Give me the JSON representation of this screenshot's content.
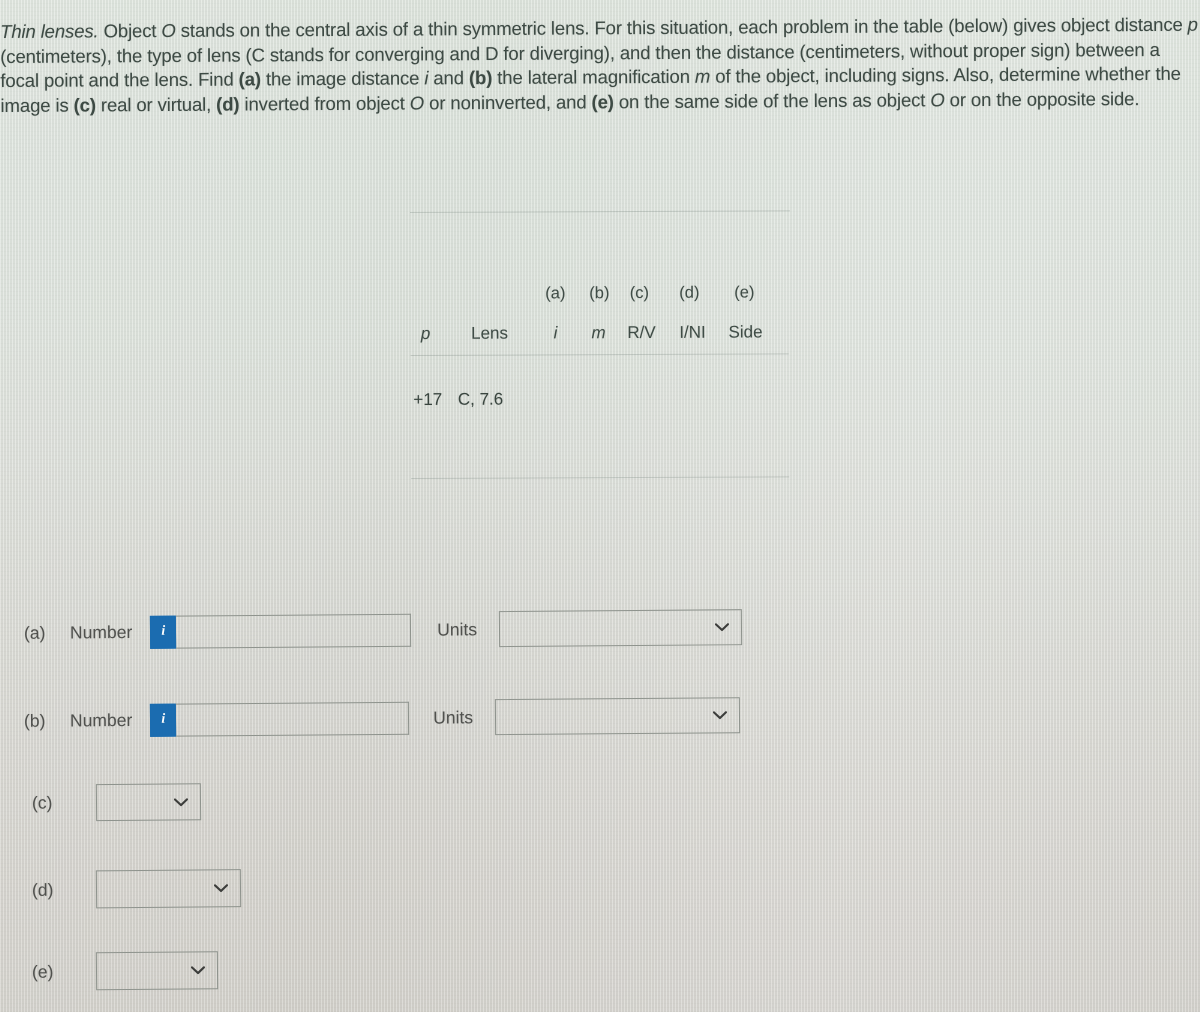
{
  "problem": {
    "title": "Thin lenses.",
    "body_segments": [
      {
        "text": " Object ",
        "style": "normal"
      },
      {
        "text": "O",
        "style": "italic"
      },
      {
        "text": " stands on the central axis of a thin symmetric lens. For this situation, each problem in the table (below) gives object distance ",
        "style": "normal"
      },
      {
        "text": "p",
        "style": "italic"
      },
      {
        "text": " (centimeters), the type of lens (C stands for converging and D for diverging), and then the distance (centimeters, without proper sign) between a focal point and the lens. Find ",
        "style": "normal"
      },
      {
        "text": "(a)",
        "style": "bold"
      },
      {
        "text": " the image distance ",
        "style": "normal"
      },
      {
        "text": "i",
        "style": "italic"
      },
      {
        "text": " and ",
        "style": "normal"
      },
      {
        "text": "(b)",
        "style": "bold"
      },
      {
        "text": " the lateral magnification ",
        "style": "normal"
      },
      {
        "text": "m",
        "style": "italic"
      },
      {
        "text": " of the object, including signs. Also, determine whether the image is ",
        "style": "normal"
      },
      {
        "text": "(c)",
        "style": "bold"
      },
      {
        "text": " real or virtual, ",
        "style": "normal"
      },
      {
        "text": "(d)",
        "style": "bold"
      },
      {
        "text": " inverted from object ",
        "style": "normal"
      },
      {
        "text": "O",
        "style": "italic"
      },
      {
        "text": " or noninverted, and ",
        "style": "normal"
      },
      {
        "text": "(e)",
        "style": "bold"
      },
      {
        "text": " on the same side of the lens as object ",
        "style": "normal"
      },
      {
        "text": "O",
        "style": "italic"
      },
      {
        "text": " or on the opposite side.",
        "style": "normal"
      }
    ],
    "full_text": "Thin lenses. Object O stands on the central axis of a thin symmetric lens. For this situation, each problem in the table (below) gives object distance p (centimeters), the type of lens (C stands for converging and D for diverging), and then the distance (centimeters, without proper sign) between a focal point and the lens. Find (a) the image distance i and (b) the lateral magnification m of the object, including signs. Also, determine whether the image is (c) real or virtual, (d) inverted from object O or noninverted, and (e) on the same side of the lens as object O or on the opposite side."
  },
  "table": {
    "part_labels": [
      "(a)",
      "(b)",
      "(c)",
      "(d)",
      "(e)"
    ],
    "columns": [
      "p",
      "Lens",
      "i",
      "m",
      "R/V",
      "I/NI",
      "Side"
    ],
    "rows": [
      {
        "p": "+17",
        "lens": "C, 7.6",
        "i": "",
        "m": "",
        "rv": "",
        "ini": "",
        "side": ""
      }
    ]
  },
  "answers": {
    "a": {
      "tag": "(a)",
      "number_label": "Number",
      "info_glyph": "i",
      "number_value": "",
      "units_label": "Units",
      "units_value": ""
    },
    "b": {
      "tag": "(b)",
      "number_label": "Number",
      "info_glyph": "i",
      "number_value": "",
      "units_label": "Units",
      "units_value": ""
    },
    "c": {
      "tag": "(c)",
      "value": ""
    },
    "d": {
      "tag": "(d)",
      "value": ""
    },
    "e": {
      "tag": "(e)",
      "value": ""
    }
  },
  "colors": {
    "accent_blue": "#1b6cb0",
    "text": "#3d4a44",
    "field_border": "#8e938d",
    "background_top": "#dfe6de",
    "background_bottom": "#d3d1cb"
  }
}
